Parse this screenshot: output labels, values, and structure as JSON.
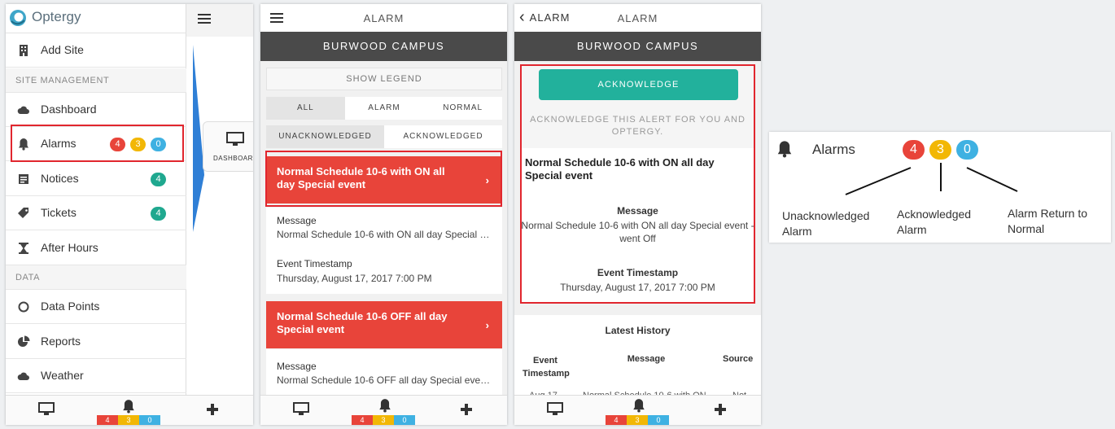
{
  "colors": {
    "red": "#e8443a",
    "yellow": "#f2b705",
    "blue": "#3fb1e2",
    "teal": "#1fa88f",
    "header_dark": "#4a4a4a",
    "highlight": "#e1262e"
  },
  "sidebar": {
    "brand": "Optergy",
    "add_site": "Add Site",
    "section_site": "SITE MANAGEMENT",
    "section_data": "DATA",
    "items": [
      {
        "label": "Dashboard",
        "icon": "cloud-icon"
      },
      {
        "label": "Alarms",
        "icon": "bell-icon"
      },
      {
        "label": "Notices",
        "icon": "notice-icon"
      },
      {
        "label": "Tickets",
        "icon": "ticket-icon"
      },
      {
        "label": "After Hours",
        "icon": "hourglass-icon"
      },
      {
        "label": "Data Points",
        "icon": "circle-icon"
      },
      {
        "label": "Reports",
        "icon": "pie-icon"
      },
      {
        "label": "Weather",
        "icon": "cloud-icon"
      }
    ],
    "alarm_badges": [
      "4",
      "3",
      "0"
    ],
    "notices_badge": "4",
    "tickets_badge": "4",
    "dashboard_peek_label": "DASHBOAR"
  },
  "tabbar": {
    "badges": [
      "4",
      "3",
      "0"
    ]
  },
  "alarm_list": {
    "title": "ALARM",
    "campus": "BURWOOD CAMPUS",
    "legend": "SHOW LEGEND",
    "filters": [
      "ALL",
      "ALARM",
      "NORMAL"
    ],
    "states": [
      "UNACKNOWLEDGED",
      "ACKNOWLEDGED"
    ],
    "cards": [
      {
        "title": "Normal Schedule 10-6 with ON all day Special event",
        "message_label": "Message",
        "message": "Normal Schedule 10-6 with ON all day Special e...",
        "ts_label": "Event Timestamp",
        "timestamp": "Thursday, August 17, 2017 7:00 PM"
      },
      {
        "title": "Normal Schedule 10-6 OFF all day Special event",
        "message_label": "Message",
        "message": "Normal Schedule 10-6 OFF all day Special event..."
      }
    ]
  },
  "alarm_detail": {
    "back_label": "ALARM",
    "title": "ALARM",
    "campus": "BURWOOD CAMPUS",
    "ack_button": "ACKNOWLEDGE",
    "ack_hint": "ACKNOWLEDGE THIS ALERT FOR YOU AND OPTERGY.",
    "event_title": "Normal Schedule 10-6 with ON all day Special event",
    "message_label": "Message",
    "message": "Normal Schedule 10-6 with ON all day Special event - went Off",
    "ts_label": "Event Timestamp",
    "timestamp": "Thursday, August 17, 2017 7:00 PM",
    "history_title": "Latest History",
    "history_cols": [
      "Event Timestamp",
      "Message",
      "Source"
    ],
    "history_row": [
      "Aug 17",
      "Normal Schedule 10-6 with ON",
      "Not"
    ]
  },
  "legend_explainer": {
    "label": "Alarms",
    "badges": [
      "4",
      "3",
      "0"
    ],
    "captions": [
      "Unacknowledged Alarm",
      "Acknowledged Alarm",
      "Alarm Return to Normal"
    ]
  }
}
